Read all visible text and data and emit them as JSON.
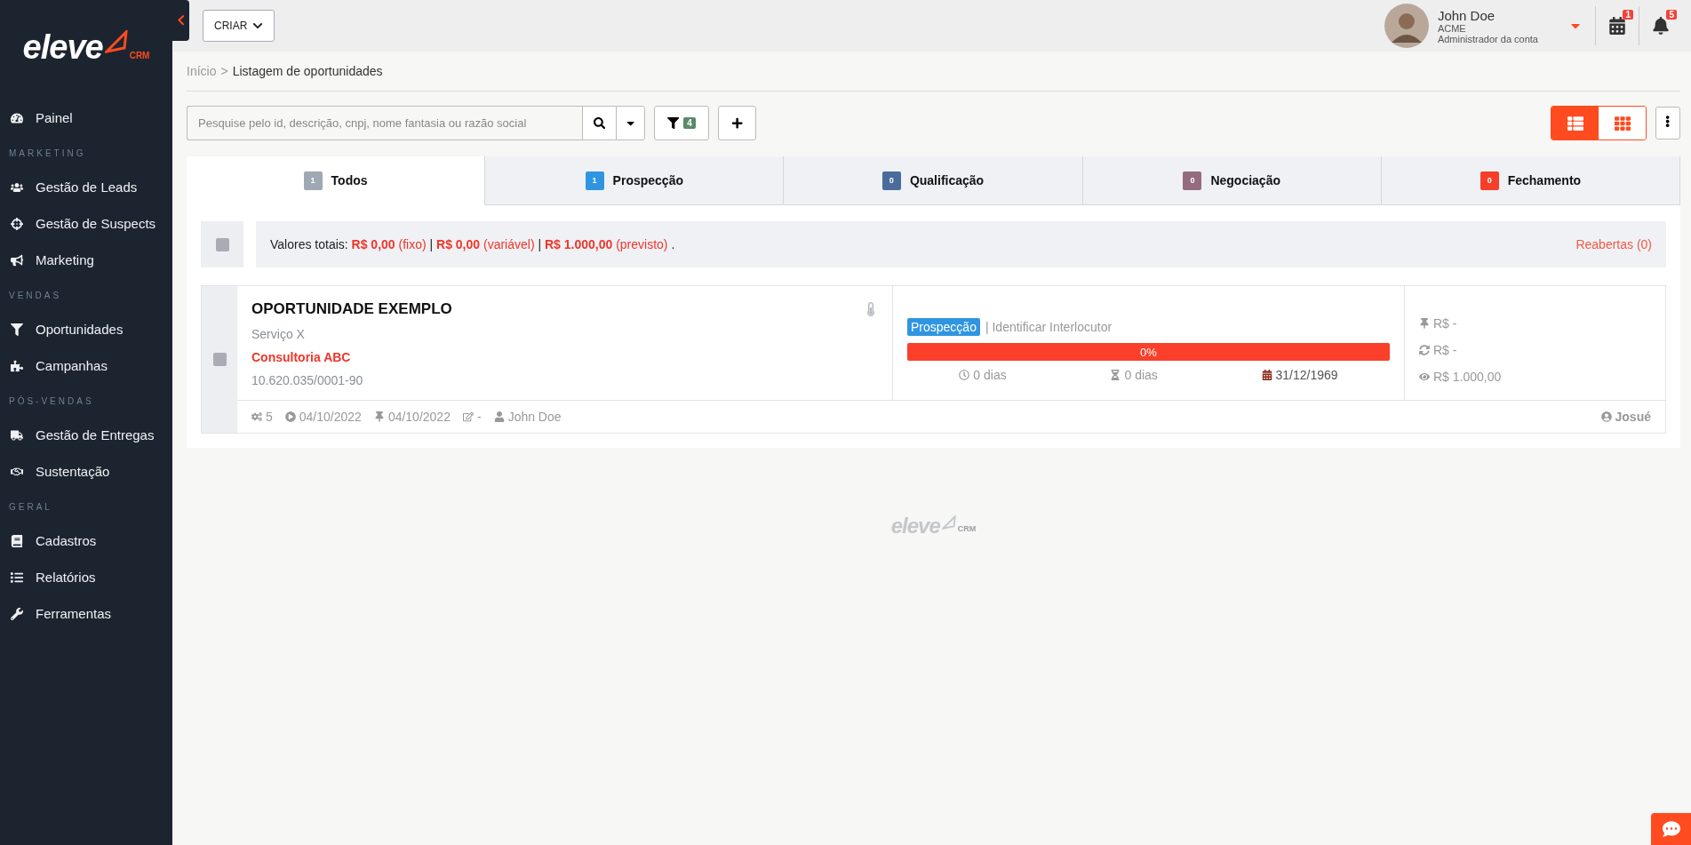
{
  "sidebar": {
    "logo": {
      "word": "eleve",
      "suffix": "CRM"
    },
    "sections": [
      {
        "items": [
          {
            "label": "Painel"
          }
        ]
      },
      {
        "heading": "MARKETING",
        "items": [
          {
            "label": "Gestão de Leads"
          },
          {
            "label": "Gestão de Suspects"
          },
          {
            "label": "Marketing"
          }
        ]
      },
      {
        "heading": "VENDAS",
        "items": [
          {
            "label": "Oportunidades"
          },
          {
            "label": "Campanhas"
          }
        ]
      },
      {
        "heading": "PÓS-VENDAS",
        "items": [
          {
            "label": "Gestão de Entregas"
          },
          {
            "label": "Sustentação"
          }
        ]
      },
      {
        "heading": "GERAL",
        "items": [
          {
            "label": "Cadastros"
          },
          {
            "label": "Relatórios"
          },
          {
            "label": "Ferramentas"
          }
        ]
      }
    ]
  },
  "topbar": {
    "create_button": "CRIAR",
    "user": {
      "name": "John Doe",
      "company": "ACME",
      "role": "Administrador da conta"
    },
    "calendar_badge": "1",
    "notifications_badge": "5"
  },
  "breadcrumb": {
    "home": "Início",
    "separator": ">",
    "current": "Listagem de oportunidades"
  },
  "toolbar": {
    "search": {
      "placeholder": "Pesquise pelo id, descrição, cnpj, nome fantasia ou razão social"
    },
    "filter_count": "4",
    "views": [
      {
        "kind": "list",
        "selected": true
      },
      {
        "kind": "grid",
        "selected": false
      }
    ]
  },
  "tabs": [
    {
      "count": "1",
      "label": "Todos",
      "color": "#a0a8b4",
      "selected": true
    },
    {
      "count": "1",
      "label": "Prospecção",
      "color": "#2f95e0",
      "selected": false
    },
    {
      "count": "0",
      "label": "Qualificação",
      "color": "#4a6c9a",
      "selected": false
    },
    {
      "count": "0",
      "label": "Negociação",
      "color": "#956b7f",
      "selected": false
    },
    {
      "count": "0",
      "label": "Fechamento",
      "color": "#f53f2a",
      "selected": false
    }
  ],
  "totals": {
    "checked": false,
    "label": "Valores totais:",
    "parts": [
      {
        "kind": "value",
        "text": "R$ 0,00"
      },
      {
        "kind": "note",
        "text": "(fixo)"
      },
      {
        "kind": "sep",
        "text": "|"
      },
      {
        "kind": "value",
        "text": "R$ 0,00"
      },
      {
        "kind": "note",
        "text": "(variável)"
      },
      {
        "kind": "sep",
        "text": "|"
      },
      {
        "kind": "value",
        "text": "R$ 1.000,00"
      },
      {
        "kind": "note",
        "text": "(previsto)"
      },
      {
        "kind": "sep",
        "text": "."
      }
    ],
    "reopened": "Reabertas (0)"
  },
  "cards": [
    {
      "checked": false,
      "title": "OPORTUNIDADE EXEMPLO",
      "service": "Serviço X",
      "client": "Consultoria ABC",
      "cnpj": "10.620.035/0001-90",
      "stage": "Prospecção",
      "step": "| Identificar Interlocutor",
      "progress": {
        "level": 0,
        "text": "0%"
      },
      "stats": [
        "0 dias",
        "0 dias",
        "31/12/1969"
      ],
      "values": [
        "R$ -",
        "R$ -",
        "R$ 1.000,00"
      ],
      "footer": [
        "5",
        "04/10/2022",
        "04/10/2022",
        "-",
        "John Doe"
      ],
      "owner": "Josué"
    }
  ],
  "footer_logo": {
    "word": "eleve",
    "suffix": "CRM"
  }
}
